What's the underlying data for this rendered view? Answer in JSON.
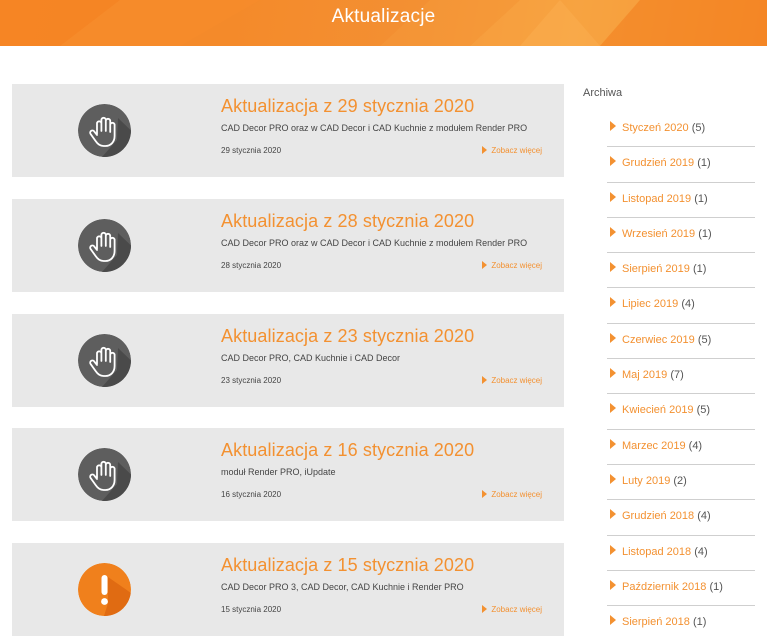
{
  "header": {
    "title": "Aktualizacje",
    "color": "#f48a2a"
  },
  "posts": [
    {
      "title": "Aktualizacja z 29 stycznia 2020",
      "description": "CAD Decor PRO oraz w CAD Decor i CAD Kuchnie z modułem Render PRO",
      "date": "29 stycznia 2020",
      "more": "Zobacz więcej",
      "icon": "hand-icon"
    },
    {
      "title": "Aktualizacja z 28 stycznia 2020",
      "description": "CAD Decor PRO oraz w CAD Decor i CAD Kuchnie z modułem Render PRO",
      "date": "28 stycznia 2020",
      "more": "Zobacz więcej",
      "icon": "hand-icon"
    },
    {
      "title": "Aktualizacja z 23 stycznia 2020",
      "description": "CAD Decor PRO, CAD Kuchnie i CAD Decor",
      "date": "23 stycznia 2020",
      "more": "Zobacz więcej",
      "icon": "hand-icon"
    },
    {
      "title": "Aktualizacja z 16 stycznia 2020",
      "description": "moduł Render PRO, iUpdate",
      "date": "16 stycznia 2020",
      "more": "Zobacz więcej",
      "icon": "hand-icon"
    },
    {
      "title": "Aktualizacja z 15 stycznia 2020",
      "description": "CAD Decor PRO 3, CAD Decor, CAD Kuchnie i Render PRO",
      "date": "15 stycznia 2020",
      "more": "Zobacz więcej",
      "icon": "exclamation-icon"
    }
  ],
  "archive": {
    "title": "Archiwa",
    "items": [
      {
        "label": "Styczeń 2020",
        "count": "(5)"
      },
      {
        "label": "Grudzień 2019",
        "count": "(1)"
      },
      {
        "label": "Listopad 2019",
        "count": "(1)"
      },
      {
        "label": "Wrzesień 2019",
        "count": "(1)"
      },
      {
        "label": "Sierpień 2019",
        "count": "(1)"
      },
      {
        "label": "Lipiec 2019",
        "count": "(4)"
      },
      {
        "label": "Czerwiec 2019",
        "count": "(5)"
      },
      {
        "label": "Maj 2019",
        "count": "(7)"
      },
      {
        "label": "Kwiecień 2019",
        "count": "(5)"
      },
      {
        "label": "Marzec 2019",
        "count": "(4)"
      },
      {
        "label": "Luty 2019",
        "count": "(2)"
      },
      {
        "label": "Grudzień 2018",
        "count": "(4)"
      },
      {
        "label": "Listopad 2018",
        "count": "(4)"
      },
      {
        "label": "Październik 2018",
        "count": "(1)"
      },
      {
        "label": "Sierpień 2018",
        "count": "(1)"
      }
    ]
  },
  "colors": {
    "accent": "#f39131",
    "card": "#e8e8e8",
    "icon_dark": "#5a5a5a",
    "icon_warning": "#f0801c"
  }
}
